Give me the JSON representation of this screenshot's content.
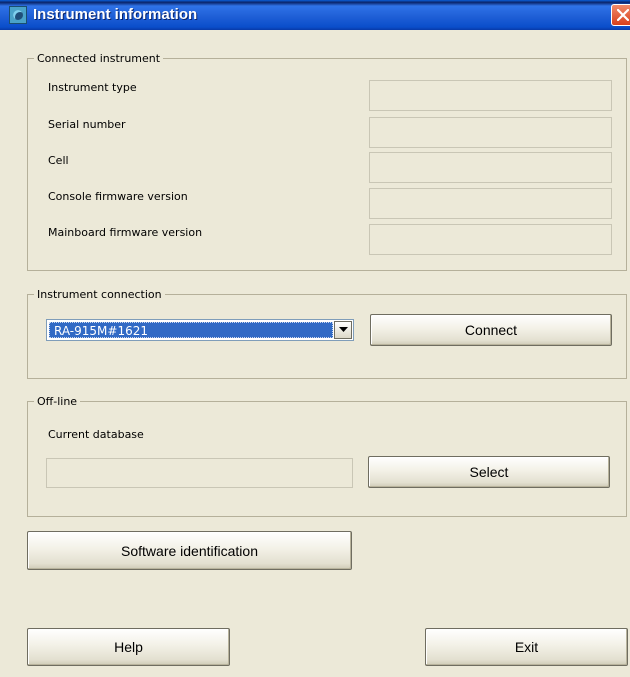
{
  "window": {
    "title": "Instrument information",
    "title_bar_color": "#0a4ecb",
    "icon": "instrument-app-icon"
  },
  "connected_instrument": {
    "legend": "Connected instrument",
    "fields": [
      {
        "label": "Instrument type",
        "value": ""
      },
      {
        "label": "Serial number",
        "value": ""
      },
      {
        "label": "Cell",
        "value": ""
      },
      {
        "label": "Console firmware version",
        "value": ""
      },
      {
        "label": "Mainboard firmware version",
        "value": ""
      }
    ]
  },
  "instrument_connection": {
    "legend": "Instrument connection",
    "selected_instrument": "RA-915M#1621",
    "connect_label": "Connect"
  },
  "offline": {
    "legend": "Off-line",
    "current_database_label": "Current database",
    "current_database_value": "",
    "select_label": "Select"
  },
  "buttons": {
    "software_identification": "Software identification",
    "help": "Help",
    "exit": "Exit"
  },
  "icons": {
    "close": "close-icon",
    "dropdown": "chevron-down-icon"
  }
}
